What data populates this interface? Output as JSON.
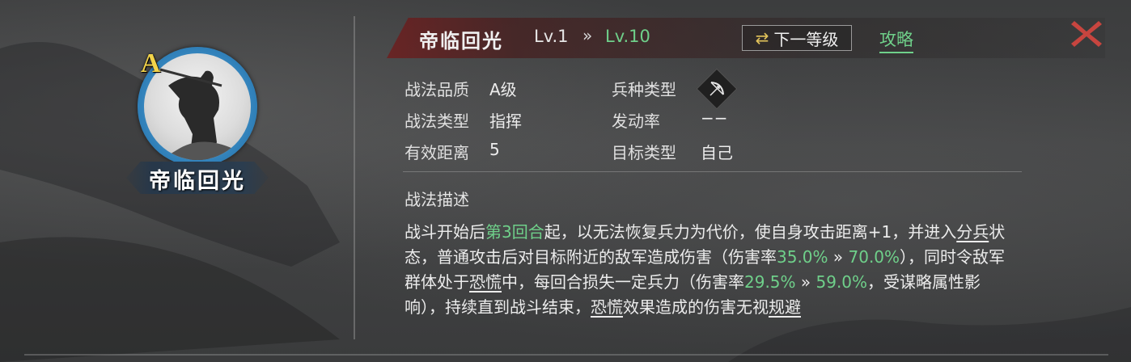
{
  "skill": {
    "grade_letter": "A",
    "name": "帝临回光",
    "level_from": "Lv.1",
    "level_arrow": "»",
    "level_to": "Lv.10"
  },
  "header": {
    "next_level_icon": "swap-arrows-icon",
    "next_level_label": "下一等级",
    "guide_label": "攻略",
    "close_icon": "close-x-icon"
  },
  "attributes": {
    "quality_label": "战法品质",
    "quality_value": "A级",
    "troop_label": "兵种类型",
    "troop_icon": "bow-icon",
    "type_label": "战法类型",
    "type_value": "指挥",
    "rate_label": "发动率",
    "rate_value": "−−",
    "range_label": "有效距离",
    "range_value": "5",
    "target_label": "目标类型",
    "target_value": "自己"
  },
  "description": {
    "title": "战法描述",
    "t1": "战斗开始后",
    "t2": "第3回合",
    "t3": "起，以无法恢复兵力为代价，使自身攻击距离+1，并进入",
    "t4": "分兵",
    "t5": "状态，普通攻击后对目标附近的敌军造成伤害（伤害率",
    "t6": "35.0%",
    "t7": " » ",
    "t8": "70.0%",
    "t9": "），同时令敌军群体处于",
    "t10": "恐慌",
    "t11": "中，每回合损失一定兵力（伤害率",
    "t12": "29.5%",
    "t13": " » ",
    "t14": "59.0%",
    "t15": "，受谋略属性影响），持续直到战斗结束，",
    "t16": "恐慌",
    "t17": "效果造成的伤害无视",
    "t18": "规避"
  },
  "colors": {
    "accent_green": "#6fd08a",
    "grade_gold": "#f2d34a",
    "close_red": "#c7453f"
  }
}
